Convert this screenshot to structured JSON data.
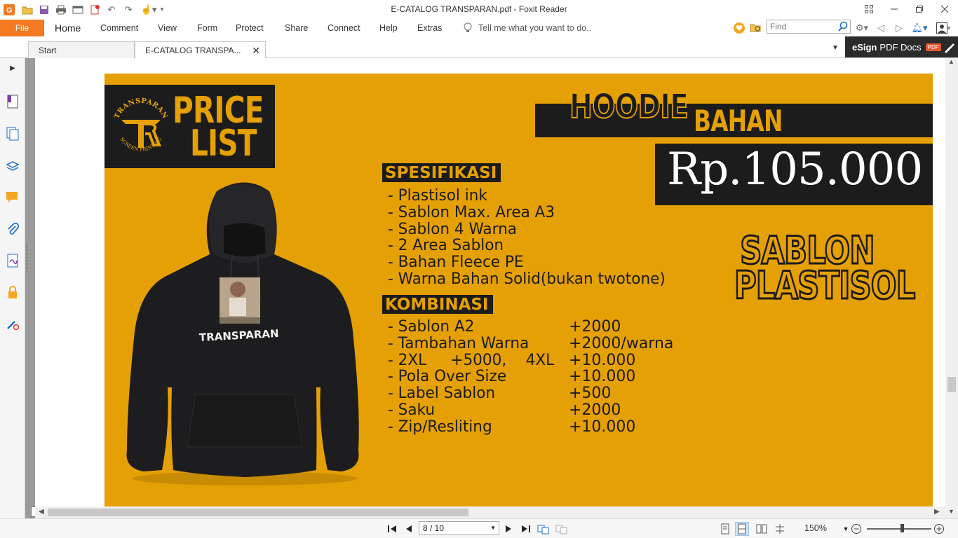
{
  "window": {
    "title": "E-CATALOG TRANSPARAN.pdf - Foxit Reader"
  },
  "menu": {
    "file": "File",
    "items": [
      "Home",
      "Comment",
      "View",
      "Form",
      "Protect",
      "Share",
      "Connect",
      "Help",
      "Extras"
    ],
    "tellme": "Tell me what you want to do..",
    "find_placeholder": "Find"
  },
  "tabs": {
    "start": "Start",
    "document": "E-CATALOG TRANSPA..."
  },
  "esign": {
    "bold": "eSign",
    "rest": "PDF Docs",
    "badge": "PDF"
  },
  "status": {
    "page": "8 / 10",
    "zoom": "150%",
    "zoom_fraction": 0.55
  },
  "page_content": {
    "logo_top": "TRANSPARAN",
    "logo_bottom": "SCREEN PRINTING",
    "price_list": [
      "PRICE",
      "LIST"
    ],
    "hoodie": "HOODIE",
    "bahan": "BAHAN FLEECE PE",
    "price": "Rp.105.000",
    "spesifikasi_label": "SPESIFIKASI",
    "spesifikasi": [
      "- Plastisol ink",
      "- Sablon Max. Area A3",
      "- Sablon 4 Warna",
      "- 2 Area Sablon",
      "- Bahan Fleece PE",
      "- Warna Bahan Solid(bukan twotone)"
    ],
    "kombinasi_label": "KOMBINASI",
    "kombinasi": [
      {
        "item": "- Sablon A2",
        "price": "+2000"
      },
      {
        "item": "- Tambahan Warna",
        "price": "+2000/warna"
      },
      {
        "item": "- 2XL     +5000,    4XL",
        "price": "+10.000"
      },
      {
        "item": "- Pola Over Size",
        "price": "+10.000"
      },
      {
        "item": "- Label Sablon",
        "price": "+500"
      },
      {
        "item": "- Saku",
        "price": "+2000"
      },
      {
        "item": "- Zip/Resliting",
        "price": "+10.000"
      }
    ],
    "sablon": [
      "SABLON",
      "PLASTISOL"
    ],
    "hoodie_print": "TRANSPARAN"
  }
}
